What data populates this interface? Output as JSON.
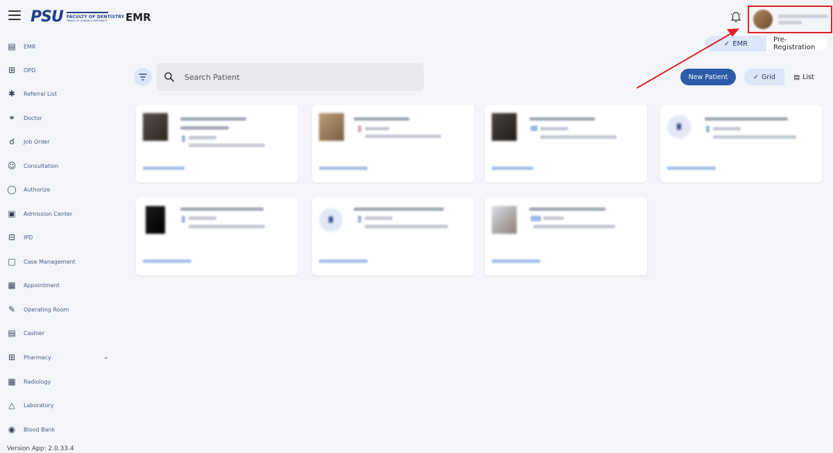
{
  "header": {
    "logo_text": "PSU",
    "logo_line1": "FACULTY OF DENTISTRY",
    "logo_line2": "PRINCE OF SONGKLA UNIVERSITY",
    "app_title": "EMR"
  },
  "mode_toggle": [
    {
      "label": "EMR",
      "selected": true
    },
    {
      "label": "Pre-Registration",
      "selected": false
    }
  ],
  "sidebar": {
    "items": [
      {
        "label": "EMR",
        "icon": "emr-icon"
      },
      {
        "label": "OPD",
        "icon": "opd-icon"
      },
      {
        "label": "Referral List",
        "icon": "referral-icon"
      },
      {
        "label": "Doctor",
        "icon": "doctor-icon"
      },
      {
        "label": "Job Order",
        "icon": "job-order-icon"
      },
      {
        "label": "Consultation",
        "icon": "consultation-icon"
      },
      {
        "label": "Authorize",
        "icon": "shield-check-icon"
      },
      {
        "label": "Admission Center",
        "icon": "admission-icon"
      },
      {
        "label": "IPD",
        "icon": "ipd-icon"
      },
      {
        "label": "Case Management",
        "icon": "case-icon"
      },
      {
        "label": "Appointment",
        "icon": "calendar-icon"
      },
      {
        "label": "Operating Room",
        "icon": "scalpel-icon"
      },
      {
        "label": "Cashier",
        "icon": "cashier-icon"
      },
      {
        "label": "Pharmacy",
        "icon": "pharmacy-icon"
      },
      {
        "label": "Radiology",
        "icon": "radiology-icon"
      },
      {
        "label": "Laboratory",
        "icon": "flask-icon"
      },
      {
        "label": "Blood Bank",
        "icon": "blood-icon"
      }
    ],
    "version": "Version App: 2.0.33.4"
  },
  "search": {
    "placeholder": "Search Patient"
  },
  "actions": {
    "new_patient": "New Patient",
    "view_options": [
      {
        "label": "Grid",
        "selected": true
      },
      {
        "label": "List",
        "selected": false
      }
    ]
  },
  "accent_color": "#2c5ba8",
  "highlight_color": "#e02020"
}
